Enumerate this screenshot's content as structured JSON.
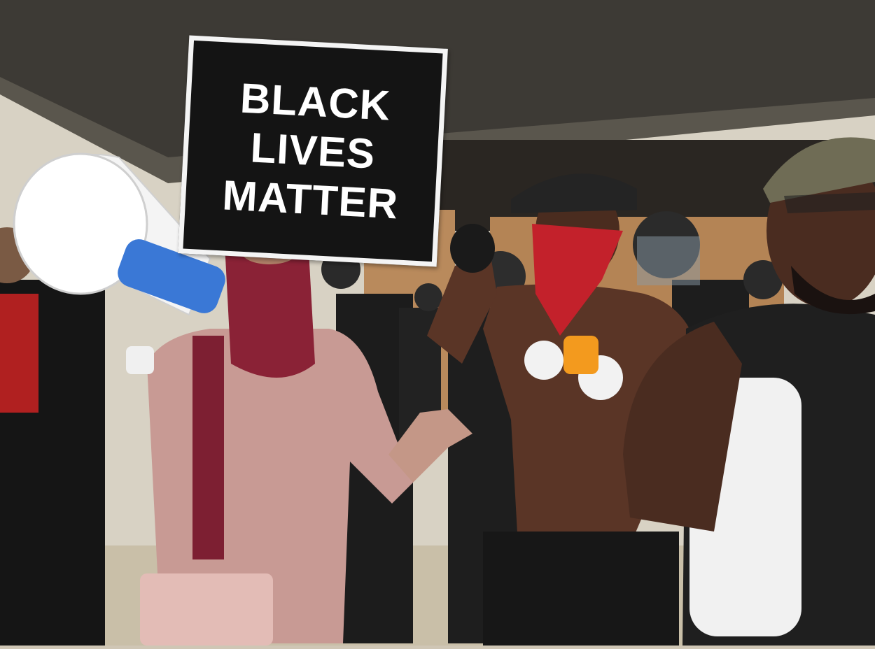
{
  "image": {
    "description_tag": "photo"
  },
  "sign": {
    "lines": [
      "BLACK",
      "LIVES",
      "MATTER"
    ]
  },
  "colors": {
    "sky_wall": "#d8d2c4",
    "soffit": "#3d3a35",
    "plywood": "#b98a5c",
    "sign_bg": "#141414",
    "sign_text": "#ffffff",
    "bandana_red": "#c3212b",
    "scarf_maroon": "#8a2236",
    "shirt_pink": "#c89a94",
    "camo_cap": "#6f6c55"
  }
}
